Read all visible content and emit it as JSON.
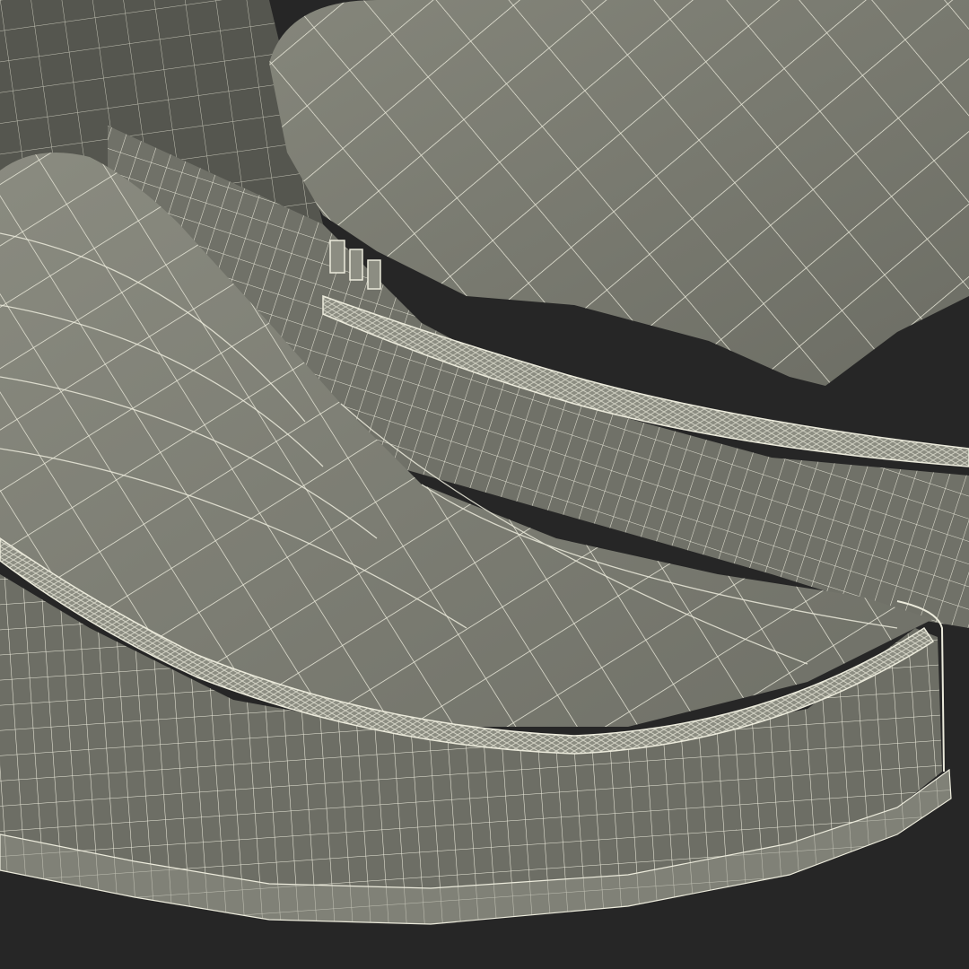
{
  "scene": {
    "subject": "wireframe-render-loafers",
    "colors": {
      "background": "#262626",
      "surface": "#7b7c72",
      "surface_dark": "#5f6058",
      "interior": "#4e4f48",
      "wire": "#ecebdc"
    }
  }
}
